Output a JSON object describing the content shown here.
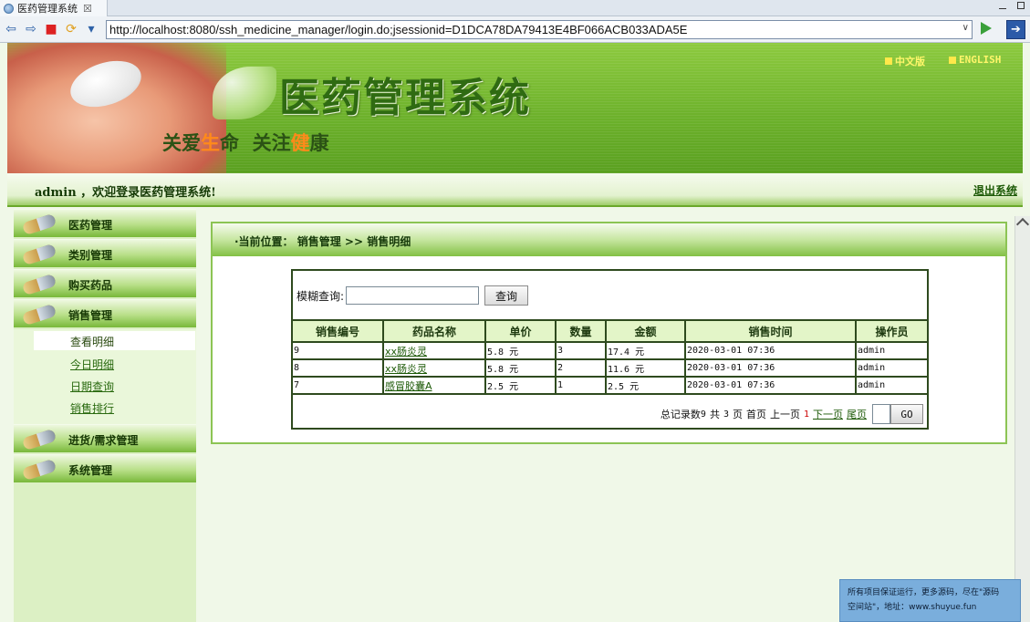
{
  "browser": {
    "tab_title": "医药管理系统",
    "tab_close": "☒",
    "url": "http://localhost:8080/ssh_medicine_manager/login.do;jsessionid=D1DCA78DA79413E4BF066ACB033ADA5E",
    "url_dropdown": "∨",
    "nav_back": "⇦",
    "nav_forward": "⇨",
    "nav_stop": "■",
    "nav_refresh": "⟳",
    "nav_menu": "▾",
    "exit": "➔"
  },
  "banner": {
    "system_title": "医药管理系统",
    "slogan_part1": "关爱",
    "slogan_hl1": "生",
    "slogan_part2": "命",
    "slogan_part3": "关注",
    "slogan_hl2": "健",
    "slogan_part4": "康",
    "lang_cn": "中文版",
    "lang_en": "ENGLISH"
  },
  "welcome": {
    "text": "admin ，欢迎登录医药管理系统!",
    "logout": "退出系统"
  },
  "sidebar": {
    "menus": [
      {
        "label": "医药管理"
      },
      {
        "label": "类别管理"
      },
      {
        "label": "购买药品"
      },
      {
        "label": "销售管理"
      },
      {
        "label": "进货/需求管理"
      },
      {
        "label": "系统管理"
      }
    ],
    "sales_submenu": [
      {
        "label": "查看明细"
      },
      {
        "label": "今日明细"
      },
      {
        "label": "日期查询"
      },
      {
        "label": "销售排行"
      }
    ]
  },
  "breadcrumb": {
    "text": "·当前位置：  销售管理 >> 销售明细"
  },
  "search": {
    "label": "模糊查询:",
    "value": "",
    "button": "查询"
  },
  "table": {
    "headers": [
      "销售编号",
      "药品名称",
      "单价",
      "数量",
      "金额",
      "销售时间",
      "操作员"
    ],
    "rows": [
      {
        "id": "9",
        "name": "xx肠炎灵",
        "price": "5.8 元",
        "qty": "3",
        "amount": "17.4 元",
        "time": "2020-03-01 07:36",
        "operator": "admin"
      },
      {
        "id": "8",
        "name": "xx肠炎灵",
        "price": "5.8 元",
        "qty": "2",
        "amount": "11.6 元",
        "time": "2020-03-01 07:36",
        "operator": "admin"
      },
      {
        "id": "7",
        "name": "感冒胶囊A",
        "price": "2.5 元",
        "qty": "1",
        "amount": "2.5 元",
        "time": "2020-03-01 07:36",
        "operator": "admin"
      }
    ]
  },
  "pager": {
    "total_label": "总记录数",
    "total": "9",
    "total_pages_prefix": "共",
    "total_pages": "3",
    "total_pages_suffix": "页",
    "first": "首页",
    "prev": "上一页",
    "current": "1",
    "next": "下一页",
    "last": "尾页",
    "page_input": "",
    "go": "GO"
  },
  "ad": {
    "line1": "所有项目保证运行，更多源码，尽在\"源码",
    "line2": "空间站\"，地址：www.shuyue.fun"
  }
}
